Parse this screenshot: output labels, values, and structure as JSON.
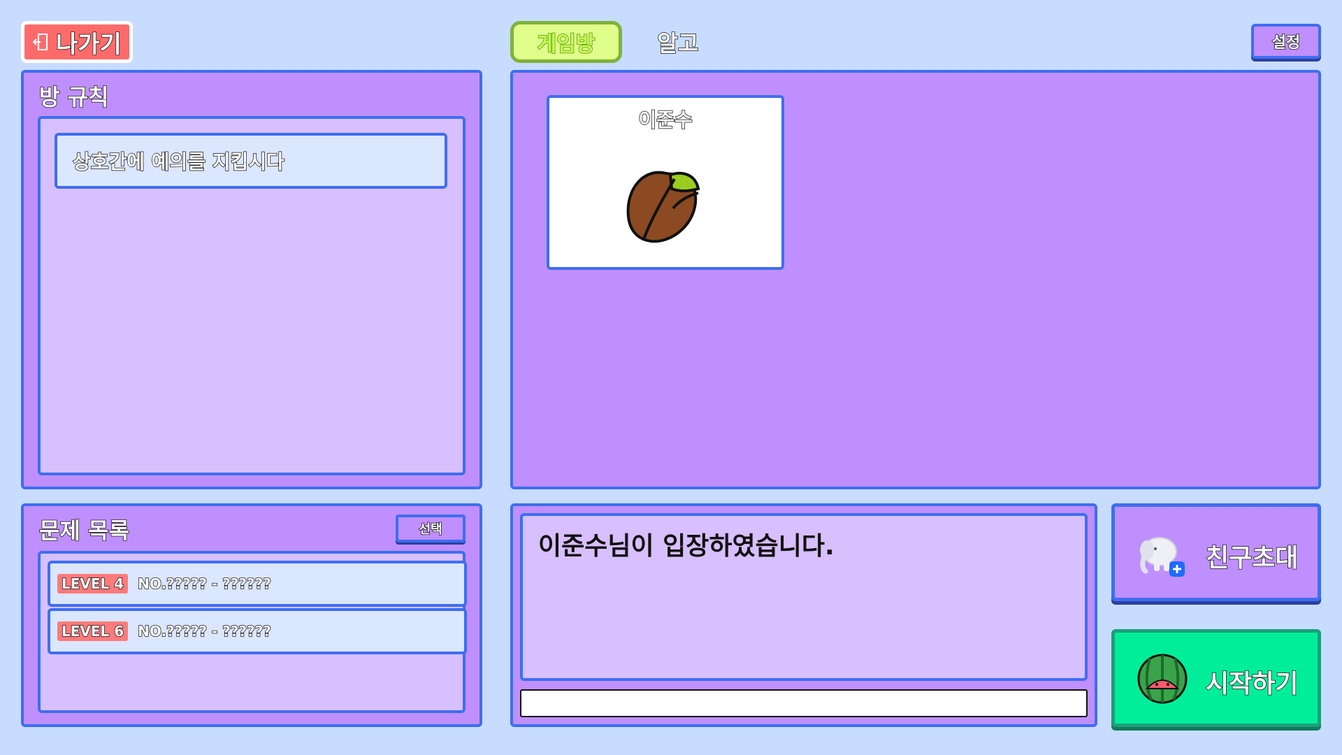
{
  "header": {
    "exit_label": "나가기",
    "tabs": [
      {
        "label": "게임방",
        "active": true
      },
      {
        "label": "알고",
        "active": false
      }
    ],
    "settings_label": "설정"
  },
  "rules": {
    "title": "방 규칙",
    "items": [
      "상호간에 예의를 지킵시다"
    ]
  },
  "players": [
    {
      "name": "이준수",
      "avatar_icon": "seed-icon"
    }
  ],
  "problems": {
    "title": "문제 목록",
    "select_label": "선택",
    "rows": [
      {
        "level": "LEVEL 4",
        "text": "NO.????? - ??????"
      },
      {
        "level": "LEVEL 6",
        "text": "NO.????? - ??????"
      }
    ]
  },
  "chat": {
    "messages": [
      "이준수님이 입장하였습니다."
    ],
    "input_value": ""
  },
  "actions": {
    "invite_label": "친구초대",
    "invite_icon": "elephant-plus-icon",
    "start_label": "시작하기",
    "start_icon": "watermelon-icon"
  },
  "colors": {
    "background": "#c8dcff",
    "panel": "#c08fff",
    "border": "#3d6ef0",
    "exit": "#ff6b6b",
    "start": "#00ee99",
    "active_tab": "#dfff8a"
  }
}
